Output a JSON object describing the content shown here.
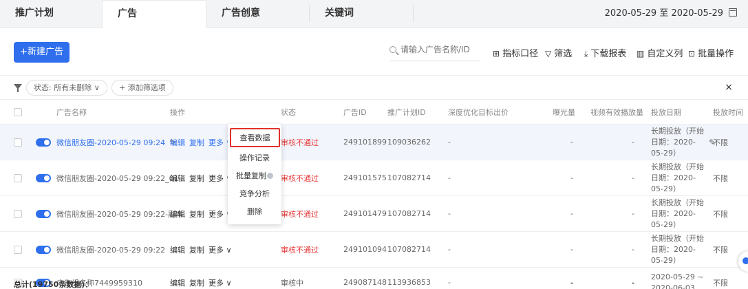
{
  "tabs": [
    "推广计划",
    "广告",
    "广告创意",
    "关键词"
  ],
  "date_range": "2020-05-29 至 2020-05-29",
  "toolbar": {
    "new_ad": "+新建广告",
    "search_placeholder": "请输入广告名称/ID",
    "metrics": "指标口径",
    "filter": "筛选",
    "download": "下载报表",
    "custom_columns": "自定义列",
    "batch": "批量操作"
  },
  "filter_bar": {
    "status_chip": "状态:  所有未删除 ∨",
    "add_filter": "+ 添加筛选项",
    "close": "×"
  },
  "columns": [
    "广告名称",
    "操作",
    "状态",
    "广告ID",
    "推广计划ID",
    "深度优化目标出价",
    "曝光量",
    "视频有效播放量",
    "投放日期",
    "投放时间"
  ],
  "operations": {
    "edit": "编辑",
    "copy": "复制",
    "more": "更多 ∨"
  },
  "rows": [
    {
      "name": "微信朋友圈-2020-05-29 09:24",
      "status": "审核不通过",
      "ad_id": "249101899",
      "plan_id": "109036262",
      "deep_bid": "-",
      "impressions": "-",
      "video_plays": "-",
      "date": "长期投放（开始日期：2020-05-29）",
      "time": "不限"
    },
    {
      "name": "微信朋友圈-2020-05-29 09:22_01",
      "status": "审核不通过",
      "ad_id": "249101575",
      "plan_id": "107082714",
      "deep_bid": "-",
      "impressions": "-",
      "video_plays": "-",
      "date": "长期投放（开始日期：2020-05-29）",
      "time": "不限"
    },
    {
      "name": "微信朋友圈-2020-05-29 09:22-副本",
      "status": "审核不通过",
      "ad_id": "249101479",
      "plan_id": "107082714",
      "deep_bid": "-",
      "impressions": "-",
      "video_plays": "-",
      "date": "长期投放（开始日期：2020-05-29）",
      "time": "不限"
    },
    {
      "name": "微信朋友圈-2020-05-29 09:22",
      "status": "审核不通过",
      "ad_id": "249101094",
      "plan_id": "107082714",
      "deep_bid": "-",
      "impressions": "-",
      "video_plays": "-",
      "date": "长期投放（开始日期：2020-05-29）",
      "time": "不限"
    },
    {
      "name": "广告组名称7449959310",
      "status": "审核中",
      "ad_id": "249087148",
      "plan_id": "113936853",
      "deep_bid": "-",
      "impressions": "-",
      "video_plays": "-",
      "date": "2020-05-29 ~ 2020-06-03",
      "time": "不限"
    }
  ],
  "dropdown": [
    "查看数据",
    "操作记录",
    "批量复制",
    "竞争分析",
    "删除"
  ],
  "total": {
    "label": "总计(19750条数据)：",
    "impressions": "-",
    "video_plays": "-"
  },
  "colors": {
    "primary": "#2f6fed",
    "error": "#e63c3c",
    "highlight_border": "#e0302a"
  }
}
